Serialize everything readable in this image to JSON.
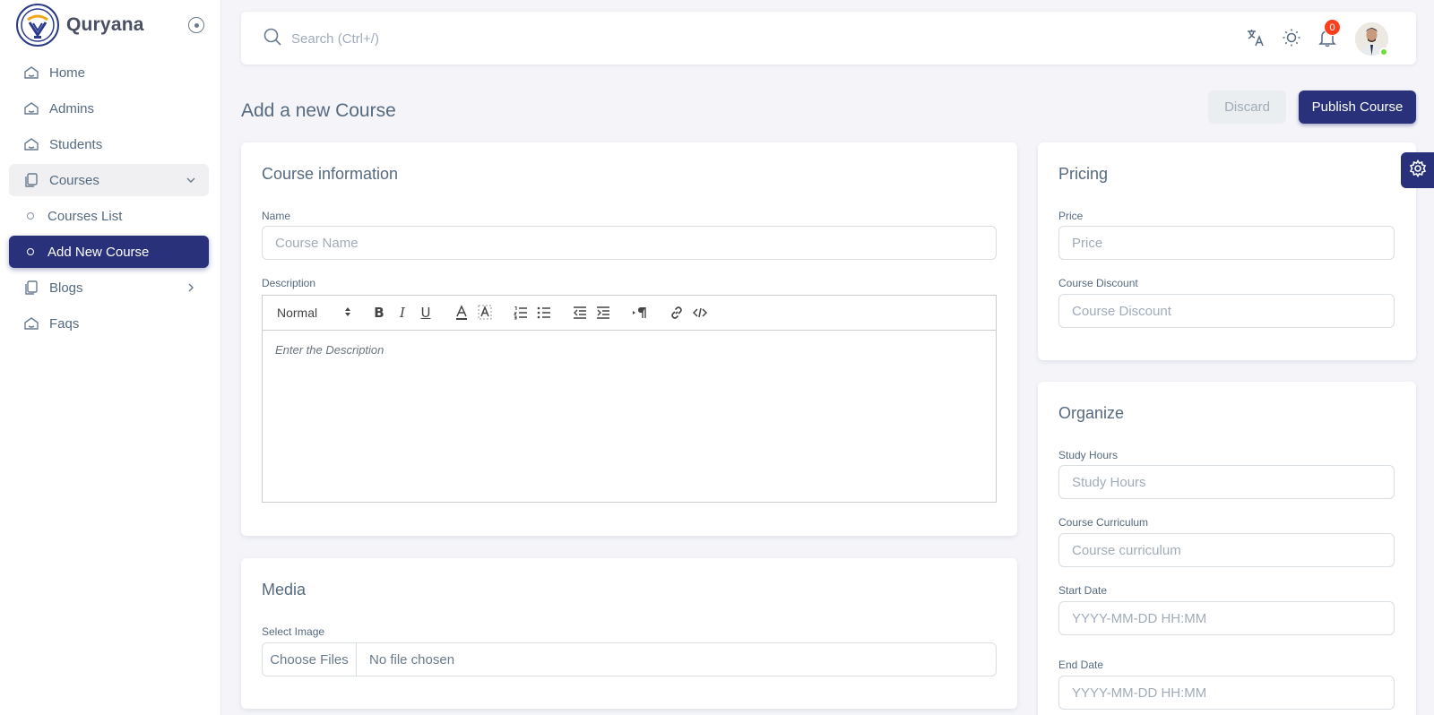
{
  "brand": {
    "name": "Quryana"
  },
  "sidebar": {
    "items": [
      {
        "label": "Home"
      },
      {
        "label": "Admins"
      },
      {
        "label": "Students"
      },
      {
        "label": "Courses"
      },
      {
        "label": "Courses List"
      },
      {
        "label": "Add New Course"
      },
      {
        "label": "Blogs"
      },
      {
        "label": "Faqs"
      }
    ]
  },
  "navbar": {
    "search_placeholder": "Search (Ctrl+/)",
    "notification_count": "0"
  },
  "page": {
    "title": "Add a new Course",
    "discard_label": "Discard",
    "publish_label": "Publish Course"
  },
  "course_info": {
    "title": "Course information",
    "name_label": "Name",
    "name_placeholder": "Course Name",
    "description_label": "Description",
    "editor_format": "Normal",
    "description_placeholder": "Enter the Description"
  },
  "media": {
    "title": "Media",
    "image_label": "Select Image",
    "choose_label": "Choose Files",
    "no_file_text": "No file chosen"
  },
  "pricing": {
    "title": "Pricing",
    "price_label": "Price",
    "price_placeholder": "Price",
    "discount_label": "Course Discount",
    "discount_placeholder": "Course Discount"
  },
  "organize": {
    "title": "Organize",
    "hours_label": "Study Hours",
    "hours_placeholder": "Study Hours",
    "curriculum_label": "Course Curriculum",
    "curriculum_placeholder": "Course curriculum",
    "start_label": "Start Date",
    "start_placeholder": "YYYY-MM-DD HH:MM",
    "end_label": "End Date",
    "end_placeholder": "YYYY-MM-DD HH:MM"
  },
  "colors": {
    "primary": "#283179",
    "danger": "#ff3e1d",
    "success": "#71dd37",
    "background": "#f5f5f9"
  },
  "icons": [
    "logo-icon",
    "collapse-toggle-icon",
    "home-icon",
    "courses-icon",
    "blogs-icon",
    "chevron-down-icon",
    "chevron-right-icon",
    "search-icon",
    "translate-icon",
    "sun-icon",
    "bell-icon",
    "gear-icon"
  ]
}
